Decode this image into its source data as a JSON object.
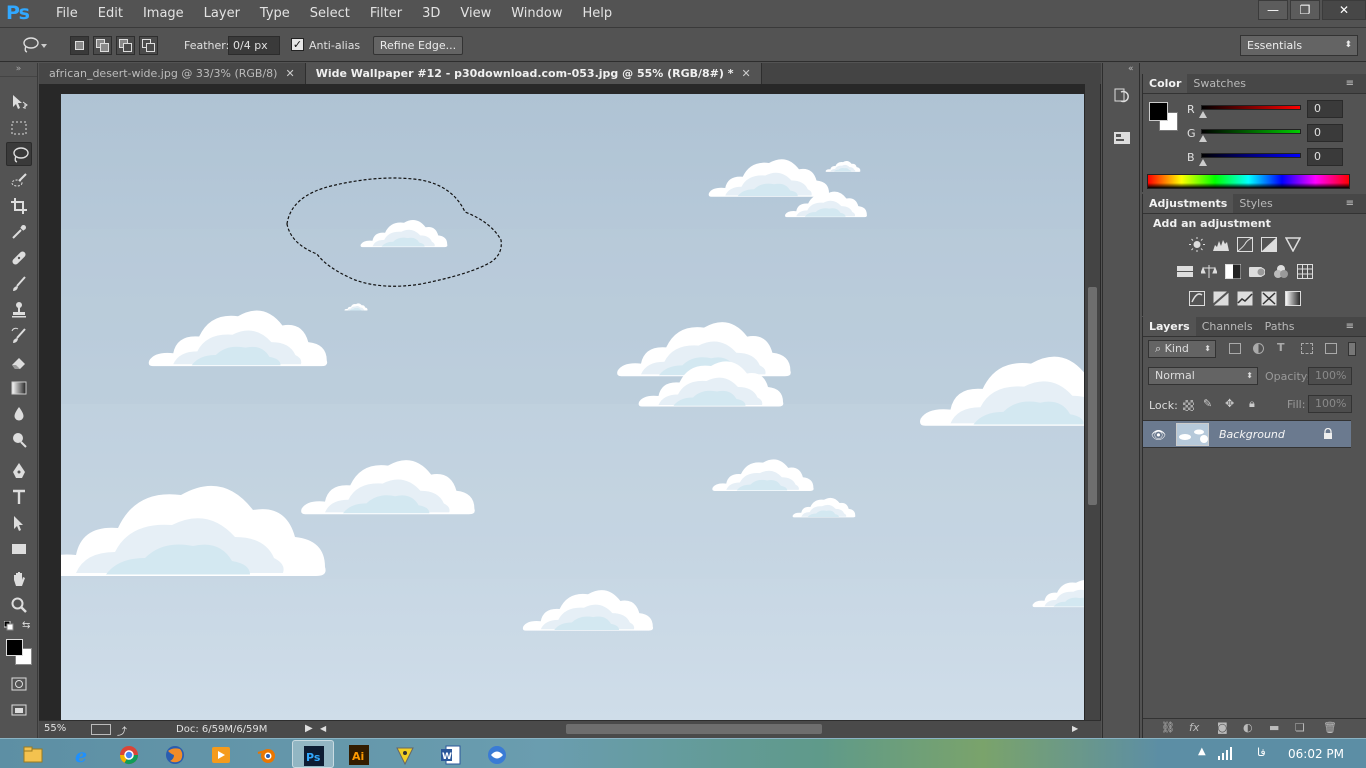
{
  "app": {
    "logo": "Ps"
  },
  "menubar": {
    "items": [
      "File",
      "Edit",
      "Image",
      "Layer",
      "Type",
      "Select",
      "Filter",
      "3D",
      "View",
      "Window",
      "Help"
    ],
    "window_controls": {
      "minimize": "—",
      "restore": "❐",
      "close": "✕"
    }
  },
  "options": {
    "feather_label": "Feather:",
    "feather_value": "0/4 px",
    "antialias_label": "Anti-alias",
    "antialias_checked": true,
    "refine_edge_label": "Refine Edge...",
    "workspace": "Essentials"
  },
  "tabs": [
    {
      "label": "african_desert-wide.jpg @ 33/3% (RGB/8)",
      "active": false,
      "close": "✕"
    },
    {
      "label": "Wide Wallpaper #12 - p30download.com-053.jpg @ 55% (RGB/8#) *",
      "active": true,
      "close": "✕"
    }
  ],
  "status": {
    "zoom": "55%",
    "doc_info": "Doc: 6/59M/6/59M"
  },
  "color_panel": {
    "tabs": [
      "Color",
      "Swatches"
    ],
    "channels": [
      {
        "label": "R",
        "value": "0",
        "bar_color": "#e00000"
      },
      {
        "label": "G",
        "value": "0",
        "bar_color": "#00c000"
      },
      {
        "label": "B",
        "value": "0",
        "bar_color": "#0000e0"
      }
    ]
  },
  "adjustments_panel": {
    "tabs": [
      "Adjustments",
      "Styles"
    ],
    "title": "Add an adjustment"
  },
  "layers_panel": {
    "tabs": [
      "Layers",
      "Channels",
      "Paths"
    ],
    "filter_kind": "Kind",
    "blend_mode": "Normal",
    "opacity_label": "Opacity:",
    "opacity_value": "100%",
    "lock_label": "Lock:",
    "fill_label": "Fill:",
    "fill_value": "100%",
    "layers": [
      {
        "name": "Background",
        "locked": true,
        "visible": true
      }
    ],
    "bottom_fx": "fx"
  },
  "taskbar": {
    "clock": "06:02 PM",
    "language": "فا",
    "apps": [
      "explorer",
      "internet-explorer",
      "chrome",
      "firefox",
      "media-player",
      "blender",
      "photoshop",
      "illustrator",
      "utility",
      "word",
      "network-tool"
    ]
  },
  "colors": {
    "canvas_sky_top": "#b1c5d6",
    "canvas_sky_bottom": "#ccdbe7",
    "cloud_white": "#ffffff",
    "cloud_shade": "#d7e9f1",
    "selection_layer": "#6b7a8f"
  }
}
